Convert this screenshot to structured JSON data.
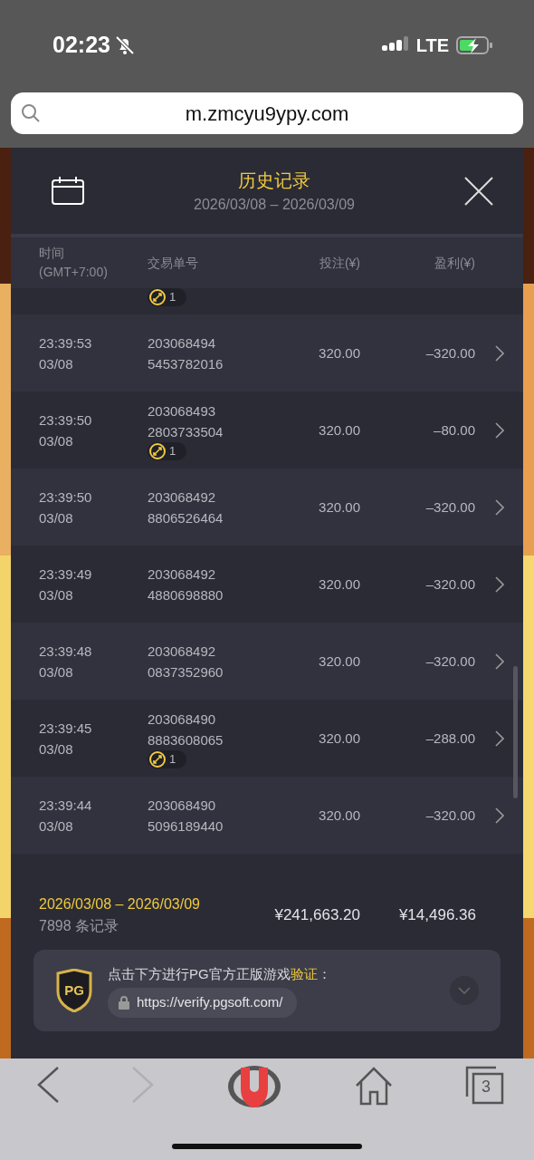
{
  "status_bar": {
    "time": "02:23",
    "network": "LTE"
  },
  "address_bar": {
    "url": "m.zmcyu9ypy.com"
  },
  "dialog": {
    "title": "历史记录",
    "date_range": "2026/03/08 – 2026/03/09"
  },
  "table": {
    "columns": [
      {
        "label": "时间",
        "sublabel": "(GMT+7:00)"
      },
      {
        "label": "交易单号"
      },
      {
        "label": "投注(¥)"
      },
      {
        "label": "盈利(¥)"
      }
    ],
    "rows": [
      {
        "kind": "partial",
        "badge": "1"
      },
      {
        "kind": "full",
        "time": "23:39:53",
        "date": "03/08",
        "id_line_1": "203068494",
        "id_line_2": "5453782016",
        "bet": "320.00",
        "profit": "–320.00"
      },
      {
        "kind": "full",
        "time": "23:39:50",
        "date": "03/08",
        "id_line_1": "203068493",
        "id_line_2": "2803733504",
        "badge": "1",
        "bet": "320.00",
        "profit": "–80.00"
      },
      {
        "kind": "full",
        "time": "23:39:50",
        "date": "03/08",
        "id_line_1": "203068492",
        "id_line_2": "8806526464",
        "bet": "320.00",
        "profit": "–320.00"
      },
      {
        "kind": "full",
        "time": "23:39:49",
        "date": "03/08",
        "id_line_1": "203068492",
        "id_line_2": "4880698880",
        "bet": "320.00",
        "profit": "–320.00"
      },
      {
        "kind": "full",
        "time": "23:39:48",
        "date": "03/08",
        "id_line_1": "203068492",
        "id_line_2": "0837352960",
        "bet": "320.00",
        "profit": "–320.00"
      },
      {
        "kind": "full",
        "time": "23:39:45",
        "date": "03/08",
        "id_line_1": "203068490",
        "id_line_2": "8883608065",
        "badge": "1",
        "bet": "320.00",
        "profit": "–288.00"
      },
      {
        "kind": "full",
        "time": "23:39:44",
        "date": "03/08",
        "id_line_1": "203068490",
        "id_line_2": "5096189440",
        "bet": "320.00",
        "profit": "–320.00"
      },
      {
        "kind": "partial"
      }
    ]
  },
  "summary": {
    "date_range": "2026/03/08 – 2026/03/09",
    "record_count": "7898 条记录",
    "total_bet": "¥241,663.20",
    "total_profit": "¥14,496.36"
  },
  "verify": {
    "logo_text": "PG",
    "text": "点击下方进行PG官方正版游戏",
    "highlight": "验证",
    "suffix": "：",
    "url": "https://verify.pgsoft.com/"
  },
  "browser_toolbar": {
    "buttons": [
      {
        "kind": "back",
        "disabled": false
      },
      {
        "kind": "forward",
        "disabled": true
      },
      {
        "kind": "app",
        "disabled": false
      },
      {
        "kind": "home",
        "disabled": false
      },
      {
        "kind": "tabs",
        "disabled": false,
        "count": "3"
      }
    ]
  }
}
